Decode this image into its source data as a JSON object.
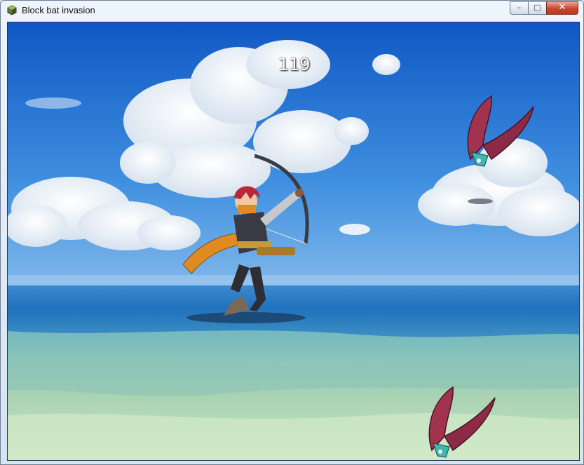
{
  "window": {
    "title": "Block bat invasion",
    "buttons": {
      "minimize_glyph": "–",
      "maximize_glyph": "□",
      "close_glyph": "✕"
    }
  },
  "hud": {
    "score": "119"
  },
  "sprites": {
    "player": "archer-hero",
    "enemies": [
      "bat-enemy",
      "bat-enemy"
    ]
  },
  "colors": {
    "sky": "#1e6fd3",
    "sea": "#2a7bc2",
    "shallows": "#9fcfb8",
    "scarf": "#e08a22",
    "bat": "#a1334f"
  }
}
